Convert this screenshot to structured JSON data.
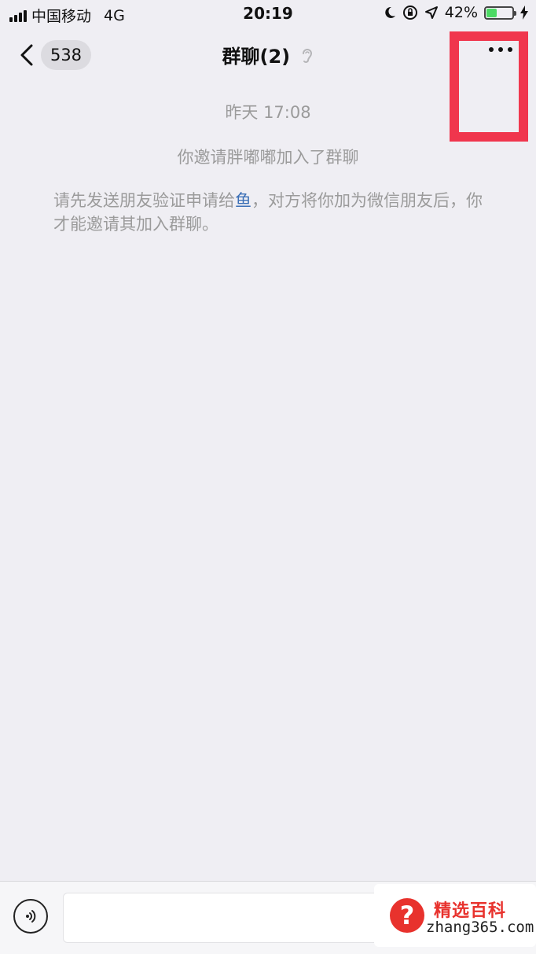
{
  "status_bar": {
    "carrier": "中国移动",
    "network": "4G",
    "time": "20:19",
    "battery_percent": "42%",
    "battery_level": 0.42
  },
  "nav": {
    "back_badge": "538",
    "title": "群聊(2)"
  },
  "chat": {
    "timestamp": "昨天 17:08",
    "system_message": "你邀请胖嘟嘟加入了群聊",
    "notice_prefix": "请先发送朋友验证申请给",
    "notice_link": "鱼",
    "notice_suffix": "，对方将你加为微信朋友后，你才能邀请其加入群聊。"
  },
  "input_bar": {
    "text_value": ""
  },
  "watermark": {
    "brand": "精选百科",
    "site": "zhang365.com"
  },
  "colors": {
    "background": "#efeef3",
    "highlight": "#f0364d",
    "link": "#3b6fb6",
    "battery": "#4cd964"
  },
  "icons": [
    "back-chevron-icon",
    "ear-icon",
    "more-icon",
    "voice-icon",
    "moon-icon",
    "rotation-lock-icon",
    "location-icon",
    "charging-icon"
  ]
}
